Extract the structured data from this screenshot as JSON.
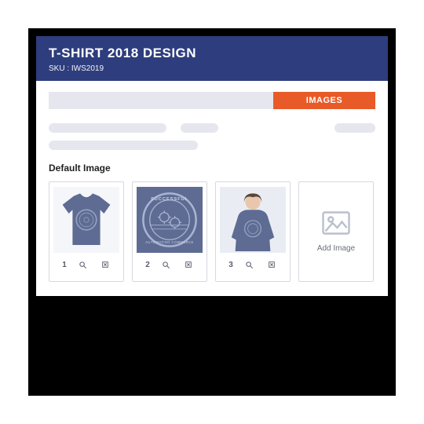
{
  "header": {
    "title": "T-SHIRT 2018 DESIGN",
    "sku_label": "SKU : IWS2019"
  },
  "tabs": {
    "active_label": "IMAGES"
  },
  "section": {
    "default_image_label": "Default Image"
  },
  "thumbnails": [
    {
      "index": "1"
    },
    {
      "index": "2"
    },
    {
      "index": "3"
    }
  ],
  "add_card": {
    "label": "Add Image"
  },
  "colors": {
    "header_bg": "#2e3d7d",
    "accent": "#e85a27",
    "skeleton": "#e6e7ee",
    "shirt": "#5e6c93"
  }
}
